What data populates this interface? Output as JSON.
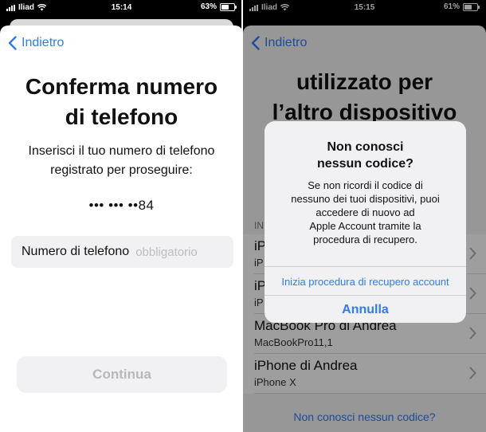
{
  "left": {
    "status": {
      "carrier": "Iliad",
      "time": "15:14",
      "battery": "63%",
      "battery_level": 0.63
    },
    "back_label": "Indietro",
    "title_line1": "Conferma numero",
    "title_line2": "di telefono",
    "subtitle_line1": "Inserisci il tuo numero di telefono",
    "subtitle_line2": "registrato per proseguire:",
    "masked_number": "••• ••• ••84",
    "field_label": "Numero di telefono",
    "field_placeholder": "obbligatorio",
    "continue_label": "Continua"
  },
  "right": {
    "status": {
      "carrier": "Iliad",
      "time": "15:15",
      "battery": "61%",
      "battery_level": 0.61
    },
    "back_label": "Indietro",
    "title_line1": "utilizzato per",
    "title_line2": "l’altro dispositivo",
    "section_header": "INI",
    "devices": [
      {
        "name": "iP",
        "model": "iP"
      },
      {
        "name": "iP",
        "model": "iP"
      },
      {
        "name": "MacBook Pro di Andrea",
        "model": "MacBookPro11,1"
      },
      {
        "name": "iPhone di Andrea",
        "model": "iPhone X"
      }
    ],
    "bottom_link": "Non conosci nessun codice?",
    "alert": {
      "title_line1": "Non conosci",
      "title_line2": "nessun codice?",
      "message_lines": [
        "Se non ricordi il codice di",
        "nessuno dei tuoi dispositivi, puoi",
        "accedere di nuovo ad",
        "Apple Account tramite la",
        "procedura di recupero."
      ],
      "action_recover": "Inizia procedura di recupero account",
      "action_cancel": "Annulla"
    }
  },
  "colors": {
    "accent": "#2f7bf5",
    "field_bg": "#f1f1f3"
  }
}
